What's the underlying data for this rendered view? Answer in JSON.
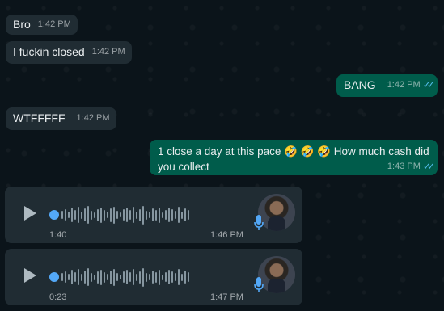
{
  "messages": [
    {
      "text": "Bro",
      "time": "1:42 PM"
    },
    {
      "text": "I fuckin closed",
      "time": "1:42 PM"
    },
    {
      "text": "BANG",
      "time": "1:42 PM"
    },
    {
      "text": "WTFFFFF",
      "time": "1:42 PM"
    },
    {
      "text_line1": "1 close a day at this pace 🤣 🤣 🤣  How much cash did",
      "text_line2": "you collect",
      "time": "1:43 PM"
    }
  ],
  "voice_notes": [
    {
      "duration": "1:40",
      "time": "1:46 PM"
    },
    {
      "duration": "0:23",
      "time": "1:47 PM"
    }
  ],
  "colors": {
    "incoming": "#202c33",
    "outgoing": "#005c4b",
    "ticks": "#53bdeb",
    "progress_dot": "#53a8f7"
  },
  "icons": [
    "play-icon",
    "microphone-icon",
    "double-check-icon"
  ]
}
